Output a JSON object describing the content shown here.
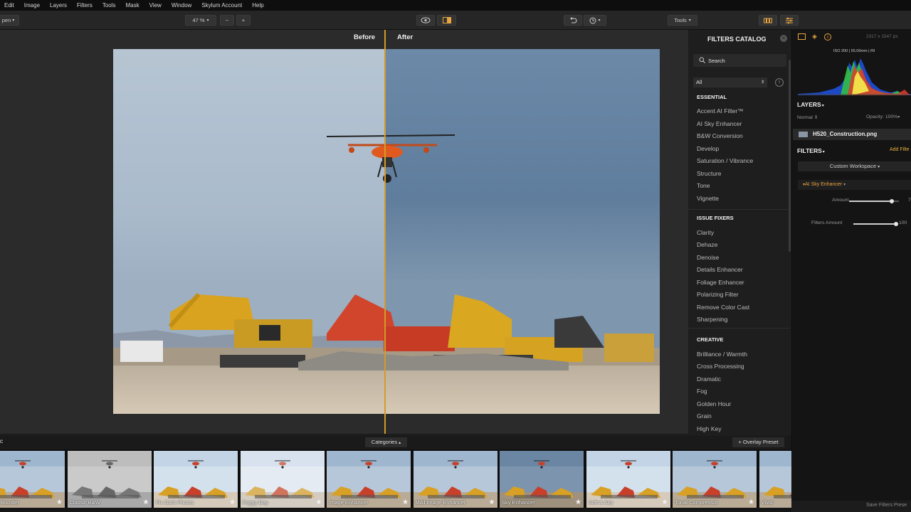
{
  "menu": {
    "items": [
      "Edit",
      "Image",
      "Layers",
      "Filters",
      "Tools",
      "Mask",
      "View",
      "Window",
      "Skylum Account",
      "Help"
    ]
  },
  "toolbar": {
    "open_label": "pen",
    "zoom_value": "47 %",
    "zoom_out": "−",
    "zoom_in": "+",
    "tools_label": "Tools"
  },
  "canvas": {
    "before_label": "Before",
    "after_label": "After",
    "split_fraction": 0.5
  },
  "catalog": {
    "title": "FILTERS CATALOG",
    "search_placeholder": "Search",
    "filter_value": "All",
    "sections": [
      {
        "name": "ESSENTIAL",
        "items": [
          "Accent AI Filter™",
          "AI Sky Enhancer",
          "B&W Conversion",
          "Develop",
          "Saturation / Vibrance",
          "Structure",
          "Tone",
          "Vignette"
        ]
      },
      {
        "name": "ISSUE FIXERS",
        "items": [
          "Clarity",
          "Dehaze",
          "Denoise",
          "Details Enhancer",
          "Foliage Enhancer",
          "Polarizing Filter",
          "Remove Color Cast",
          "Sharpening"
        ]
      },
      {
        "name": "CREATIVE",
        "items": [
          "Brilliance / Warmth",
          "Cross Processing",
          "Dramatic",
          "Fog",
          "Golden Hour",
          "Grain",
          "High Key"
        ]
      }
    ]
  },
  "right_panel": {
    "image_dims": "2317 x 1547 px",
    "exif": "ISO 200  |  55.00mm  |  f/9",
    "layers_title": "LAYERS",
    "blend_mode": "Normal",
    "opacity": "Opacity: 100%",
    "layer_name": "H520_Construction.png",
    "filters_title": "FILTERS",
    "add_filter": "Add Filte",
    "workspace": "Custom Workspace",
    "active_filter": "AI Sky Enhancer",
    "amount_label": "Amount",
    "amount_value": "7",
    "amount_fraction": 0.85,
    "filters_amount_label": "Filters Amount",
    "filters_amount_value": "100",
    "filters_amount_fraction": 1.0,
    "save_presets": "Save Filters Prese"
  },
  "filmstrip": {
    "group_letter": "c",
    "categories_label": "Categories",
    "overlay_label": "+ Overlay Preset",
    "presets": [
      {
        "label": "Booster",
        "style": "color"
      },
      {
        "label": "Classic B&W",
        "style": "bw"
      },
      {
        "label": "Fix Dark Photos",
        "style": "bright"
      },
      {
        "label": "Foggy Day",
        "style": "foggy"
      },
      {
        "label": "Image Enhancer",
        "style": "color"
      },
      {
        "label": "Mild Image Enhancer",
        "style": "color"
      },
      {
        "label": "Sky Enhancer",
        "style": "dark"
      },
      {
        "label": "Soft & Airy",
        "style": "bright"
      },
      {
        "label": "Tonal Compressor",
        "style": "color"
      },
      {
        "label": "Vivid",
        "style": "color"
      }
    ]
  },
  "colors": {
    "accent": "#d49a2a",
    "orange_text": "#e8a640"
  }
}
